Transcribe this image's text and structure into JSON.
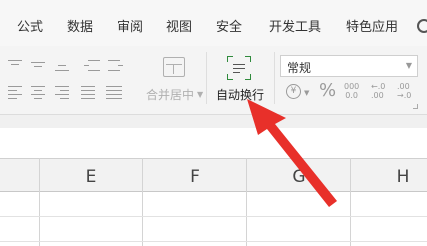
{
  "menu": {
    "items": [
      "公式",
      "数据",
      "审阅",
      "视图",
      "安全",
      "开发工具",
      "特色应用"
    ]
  },
  "ribbon": {
    "merge_label": "合并居中",
    "wrap_label": "自动换行",
    "number_format_value": "常规",
    "percent_symbol": "%",
    "currency_symbol": "¥",
    "thousands_top": "000",
    "thousands_bottom": "0.0",
    "increase_decimal_top": "←.0",
    "increase_decimal_bottom": ".00",
    "decrease_decimal_top": ".00",
    "decrease_decimal_bottom": "→.0"
  },
  "sheet": {
    "columns": [
      "E",
      "F",
      "G",
      "H"
    ]
  },
  "colors": {
    "arrow": "#e8302a",
    "wrap_icon_accent": "#2f8a3c"
  }
}
